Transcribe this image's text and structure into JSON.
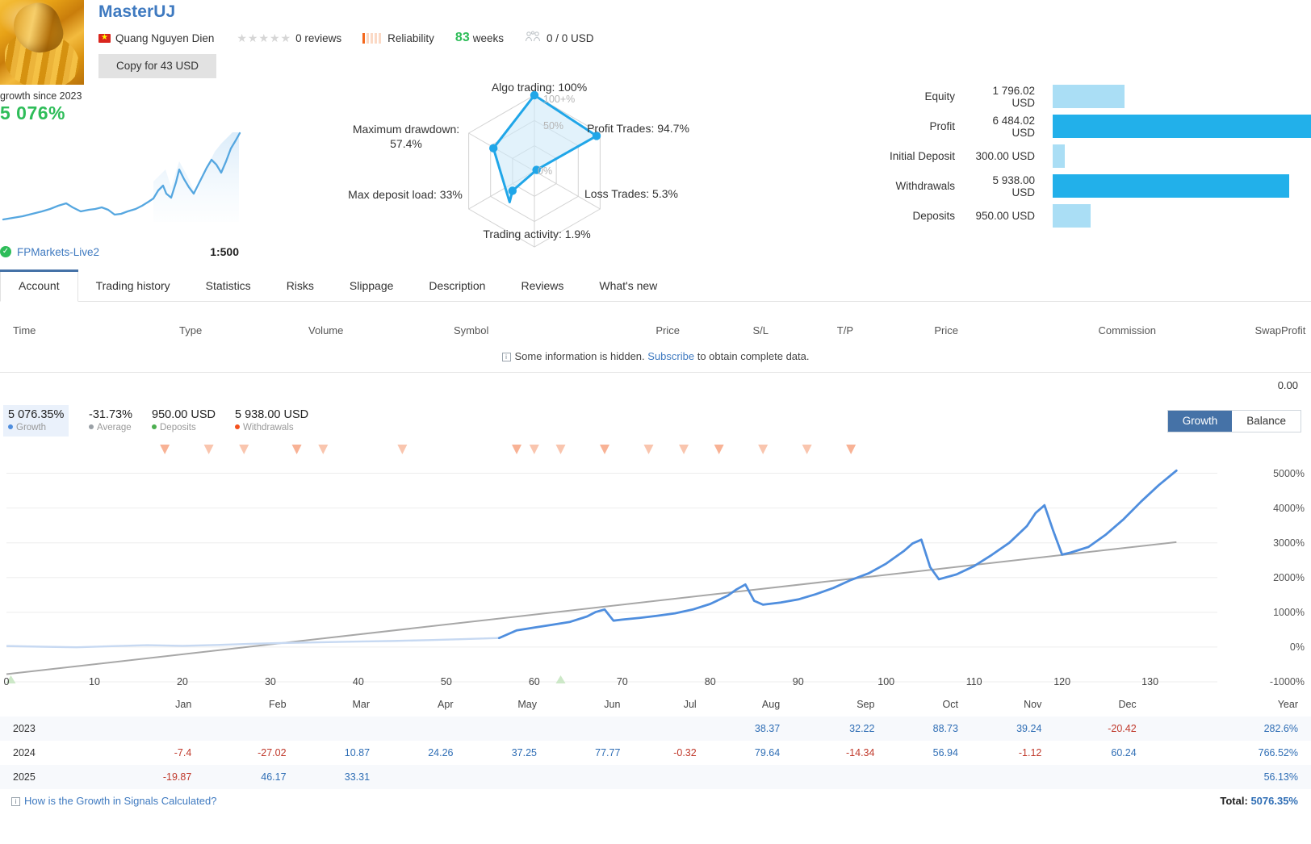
{
  "header": {
    "title": "MasterUJ",
    "author": "Quang Nguyen Dien",
    "reviews": "0 reviews",
    "reliability_label": "Reliability",
    "weeks_number": "83",
    "weeks_label": "weeks",
    "subscribers": "0 / 0 USD",
    "copy_button": "Copy for 43 USD",
    "avatar_icon": "honey-jar-image",
    "flag_icon": "vietnam-flag-icon",
    "stars_icon": "rating-stars-icon",
    "subscribers_icon": "users-icon"
  },
  "growth_panel": {
    "since_label": "growth since 2023",
    "value": "5 076%",
    "broker": "FPMarkets-Live2",
    "leverage": "1:500",
    "verified_icon": "verified-check-icon"
  },
  "radar": {
    "title": "account-quality-radar",
    "axes": [
      {
        "label": "Algo trading: 100%",
        "value": 100
      },
      {
        "label": "Profit Trades: 94.7%",
        "value": 94.7
      },
      {
        "label": "Loss Trades: 5.3%",
        "value": 5.3
      },
      {
        "label": "Trading activity: 1.9%",
        "value": 1.9
      },
      {
        "label": "Max deposit load: 33%",
        "value": 33
      },
      {
        "label": "Maximum drawdown: 57.4%",
        "value": 57.4
      }
    ],
    "ring_labels": [
      "100+%",
      "50%",
      "0%"
    ]
  },
  "stats": {
    "rows": [
      {
        "label": "Equity",
        "value": "1 796.02 USD",
        "pct": 27.7,
        "color": "#aadef5"
      },
      {
        "label": "Profit",
        "value": "6 484.02 USD",
        "pct": 100,
        "color": "#22b0ea"
      },
      {
        "label": "Initial Deposit",
        "value": "300.00 USD",
        "pct": 4.6,
        "color": "#aadef5"
      },
      {
        "label": "Withdrawals",
        "value": "5 938.00 USD",
        "pct": 91.6,
        "color": "#22b0ea"
      },
      {
        "label": "Deposits",
        "value": "950.00 USD",
        "pct": 14.6,
        "color": "#aadef5"
      }
    ]
  },
  "tabs": {
    "items": [
      "Account",
      "Trading history",
      "Statistics",
      "Risks",
      "Slippage",
      "Description",
      "Reviews",
      "What's new"
    ],
    "active": "Account"
  },
  "deal_table": {
    "columns": [
      "Time",
      "Type",
      "Volume",
      "Symbol",
      "Price",
      "S/L",
      "T/P",
      "Price",
      "Commission",
      "Swap",
      "Profit"
    ],
    "hidden_note_before": "Some information is hidden.",
    "hidden_note_link": "Subscribe",
    "hidden_note_after": "to obtain complete data.",
    "total": "0.00"
  },
  "chart_legend": {
    "items": [
      {
        "value": "5 076.35%",
        "name": "Growth",
        "color": "#4f8ede",
        "selected": true
      },
      {
        "value": "-31.73%",
        "name": "Average",
        "color": "#9aa0a6",
        "selected": false
      },
      {
        "value": "950.00 USD",
        "name": "Deposits",
        "color": "#4caf50",
        "selected": false
      },
      {
        "value": "5 938.00 USD",
        "name": "Withdrawals",
        "color": "#f4511e",
        "selected": false
      }
    ],
    "toggle": {
      "options": [
        "Growth",
        "Balance"
      ],
      "active": "Growth"
    }
  },
  "chart_data": {
    "type": "line",
    "title": "Growth",
    "xlabel": "",
    "ylabel": "",
    "xlim": [
      0,
      136
    ],
    "ylim": [
      -1000,
      5500
    ],
    "grid": true,
    "legend_position": "top-left",
    "xticks": [
      0,
      10,
      20,
      30,
      40,
      50,
      60,
      70,
      80,
      90,
      100,
      110,
      120,
      130
    ],
    "yticks": [
      -1000,
      0,
      1000,
      2000,
      3000,
      4000,
      5000
    ],
    "ytick_labels": [
      "-1000%",
      "0%",
      "1000%",
      "2000%",
      "3000%",
      "4000%",
      "5000%"
    ],
    "series": [
      {
        "name": "Growth",
        "color": "#4f8ede",
        "points": [
          [
            0,
            30
          ],
          [
            4,
            10
          ],
          [
            8,
            -5
          ],
          [
            12,
            25
          ],
          [
            16,
            55
          ],
          [
            20,
            35
          ],
          [
            24,
            60
          ],
          [
            28,
            95
          ],
          [
            32,
            120
          ],
          [
            36,
            140
          ],
          [
            40,
            160
          ],
          [
            44,
            175
          ],
          [
            48,
            200
          ],
          [
            52,
            230
          ],
          [
            56,
            260
          ],
          [
            58,
            480
          ],
          [
            60,
            560
          ],
          [
            62,
            640
          ],
          [
            64,
            720
          ],
          [
            66,
            880
          ],
          [
            67,
            1010
          ],
          [
            68,
            1080
          ],
          [
            69,
            760
          ],
          [
            70,
            790
          ],
          [
            72,
            840
          ],
          [
            74,
            900
          ],
          [
            76,
            970
          ],
          [
            78,
            1080
          ],
          [
            80,
            1240
          ],
          [
            82,
            1480
          ],
          [
            83,
            1660
          ],
          [
            84,
            1800
          ],
          [
            85,
            1330
          ],
          [
            86,
            1220
          ],
          [
            88,
            1280
          ],
          [
            90,
            1370
          ],
          [
            92,
            1520
          ],
          [
            94,
            1700
          ],
          [
            96,
            1930
          ],
          [
            98,
            2120
          ],
          [
            100,
            2400
          ],
          [
            102,
            2760
          ],
          [
            103,
            2980
          ],
          [
            104,
            3090
          ],
          [
            105,
            2300
          ],
          [
            106,
            1950
          ],
          [
            108,
            2090
          ],
          [
            110,
            2330
          ],
          [
            112,
            2650
          ],
          [
            114,
            3000
          ],
          [
            116,
            3480
          ],
          [
            117,
            3860
          ],
          [
            118,
            4080
          ],
          [
            119,
            3340
          ],
          [
            120,
            2660
          ],
          [
            121,
            2720
          ],
          [
            123,
            2880
          ],
          [
            125,
            3240
          ],
          [
            127,
            3680
          ],
          [
            129,
            4190
          ],
          [
            131,
            4660
          ],
          [
            133,
            5076
          ]
        ]
      },
      {
        "name": "Average",
        "color": "#9aa0a6",
        "points": [
          [
            0,
            -780
          ],
          [
            133,
            3020
          ]
        ]
      }
    ],
    "withdrawal_markers": [
      18,
      23,
      27,
      33,
      36,
      45,
      58,
      60,
      63,
      68,
      73,
      77,
      81,
      86,
      91,
      96
    ],
    "deposit_markers": [
      0.5,
      63
    ]
  },
  "monthly_table": {
    "months": [
      "Jan",
      "Feb",
      "Mar",
      "Apr",
      "May",
      "Jun",
      "Jul",
      "Aug",
      "Sep",
      "Oct",
      "Nov",
      "Dec",
      "Year"
    ],
    "rows": [
      {
        "year": "2023",
        "values": [
          "",
          "",
          "",
          "",
          "",
          "",
          "",
          "38.37",
          "32.22",
          "88.73",
          "39.24",
          "-20.42",
          "282.6%"
        ]
      },
      {
        "year": "2024",
        "values": [
          "-7.4",
          "-27.02",
          "10.87",
          "24.26",
          "37.25",
          "77.77",
          "-0.32",
          "79.64",
          "-14.34",
          "56.94",
          "-1.12",
          "60.24",
          "766.52%"
        ]
      },
      {
        "year": "2025",
        "values": [
          "-19.87",
          "46.17",
          "33.31",
          "",
          "",
          "",
          "",
          "",
          "",
          "",
          "",
          "",
          "56.13%"
        ]
      }
    ]
  },
  "footer": {
    "link": "How is the Growth in Signals Calculated?",
    "total_label": "Total:",
    "total_value": "5076.35%"
  }
}
